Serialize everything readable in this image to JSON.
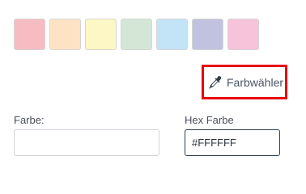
{
  "swatches": [
    {
      "color": "#f6bcc1",
      "name": "swatch-red"
    },
    {
      "color": "#fde3c4",
      "name": "swatch-orange"
    },
    {
      "color": "#fcf7c4",
      "name": "swatch-yellow"
    },
    {
      "color": "#d4e6d6",
      "name": "swatch-green"
    },
    {
      "color": "#c3e3f6",
      "name": "swatch-blue"
    },
    {
      "color": "#c0c2e0",
      "name": "swatch-purple"
    },
    {
      "color": "#f6c3db",
      "name": "swatch-pink"
    }
  ],
  "picker": {
    "label": "Farbwähler",
    "icon": "eyedropper-icon",
    "highlight_color": "#e8000c"
  },
  "fields": {
    "farbe_label": "Farbe:",
    "farbe_value": "",
    "hex_label": "Hex Farbe",
    "hex_value": "#FFFFFF"
  }
}
